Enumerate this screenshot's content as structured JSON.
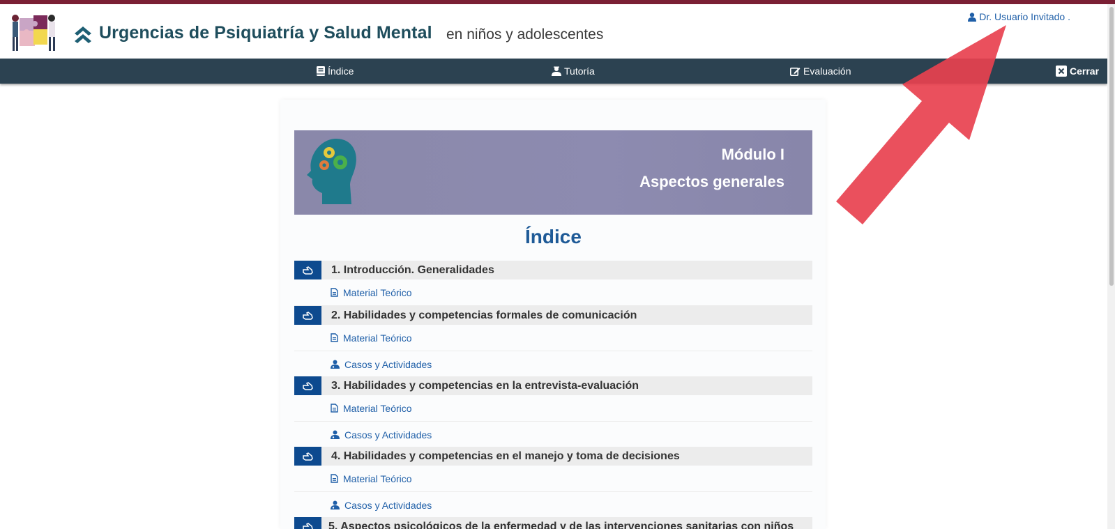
{
  "header": {
    "title": "Urgencias de Psiquiatría y Salud Mental",
    "subtitle": "en niños y adolescentes",
    "user_label": "Dr. Usuario Invitado .",
    "icons": [
      "puzzle-logo",
      "chevron-up-icon",
      "user-icon"
    ]
  },
  "nav": {
    "indice": "Índice",
    "tutoria": "Tutoría",
    "evaluacion": "Evaluación",
    "cerrar": "Cerrar"
  },
  "banner": {
    "line1": "Módulo I",
    "line2": "Aspectos generales"
  },
  "index": {
    "title": "Índice",
    "sections": [
      {
        "title": "1. Introducción. Generalidades",
        "links": [
          "Material Teórico"
        ]
      },
      {
        "title": "2. Habilidades y competencias formales de comunicación",
        "links": [
          "Material Teórico",
          "Casos y Actividades"
        ]
      },
      {
        "title": "3. Habilidades y competencias en la entrevista-evaluación",
        "links": [
          "Material Teórico",
          "Casos y Actividades"
        ]
      },
      {
        "title": "4. Habilidades y competencias en el manejo y toma de decisiones",
        "links": [
          "Material Teórico",
          "Casos y Actividades"
        ]
      },
      {
        "title": "5. Aspectos psicológicos de la enfermedad y de las intervenciones sanitarias con niños",
        "links": []
      }
    ]
  },
  "colors": {
    "topbar": "#7a1f34",
    "navbar": "#2c4251",
    "accent": "#0d4a8f",
    "link": "#1f5fa8",
    "annotation_arrow": "#e8414f"
  }
}
